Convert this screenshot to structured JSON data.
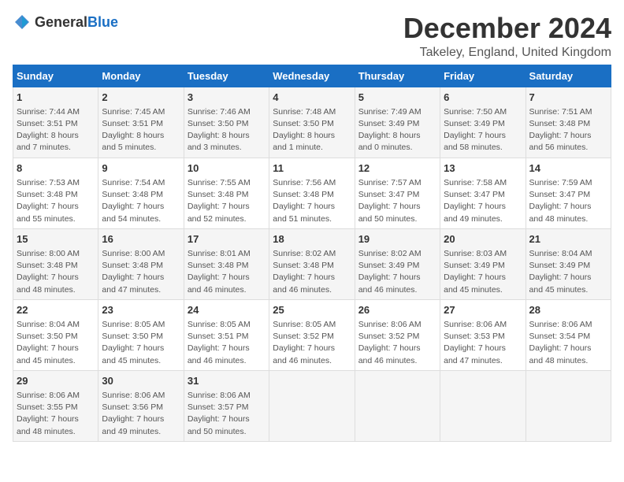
{
  "logo": {
    "general": "General",
    "blue": "Blue"
  },
  "title": "December 2024",
  "subtitle": "Takeley, England, United Kingdom",
  "days_of_week": [
    "Sunday",
    "Monday",
    "Tuesday",
    "Wednesday",
    "Thursday",
    "Friday",
    "Saturday"
  ],
  "weeks": [
    [
      {
        "day": "1",
        "info": "Sunrise: 7:44 AM\nSunset: 3:51 PM\nDaylight: 8 hours\nand 7 minutes."
      },
      {
        "day": "2",
        "info": "Sunrise: 7:45 AM\nSunset: 3:51 PM\nDaylight: 8 hours\nand 5 minutes."
      },
      {
        "day": "3",
        "info": "Sunrise: 7:46 AM\nSunset: 3:50 PM\nDaylight: 8 hours\nand 3 minutes."
      },
      {
        "day": "4",
        "info": "Sunrise: 7:48 AM\nSunset: 3:50 PM\nDaylight: 8 hours\nand 1 minute."
      },
      {
        "day": "5",
        "info": "Sunrise: 7:49 AM\nSunset: 3:49 PM\nDaylight: 8 hours\nand 0 minutes."
      },
      {
        "day": "6",
        "info": "Sunrise: 7:50 AM\nSunset: 3:49 PM\nDaylight: 7 hours\nand 58 minutes."
      },
      {
        "day": "7",
        "info": "Sunrise: 7:51 AM\nSunset: 3:48 PM\nDaylight: 7 hours\nand 56 minutes."
      }
    ],
    [
      {
        "day": "8",
        "info": "Sunrise: 7:53 AM\nSunset: 3:48 PM\nDaylight: 7 hours\nand 55 minutes."
      },
      {
        "day": "9",
        "info": "Sunrise: 7:54 AM\nSunset: 3:48 PM\nDaylight: 7 hours\nand 54 minutes."
      },
      {
        "day": "10",
        "info": "Sunrise: 7:55 AM\nSunset: 3:48 PM\nDaylight: 7 hours\nand 52 minutes."
      },
      {
        "day": "11",
        "info": "Sunrise: 7:56 AM\nSunset: 3:48 PM\nDaylight: 7 hours\nand 51 minutes."
      },
      {
        "day": "12",
        "info": "Sunrise: 7:57 AM\nSunset: 3:47 PM\nDaylight: 7 hours\nand 50 minutes."
      },
      {
        "day": "13",
        "info": "Sunrise: 7:58 AM\nSunset: 3:47 PM\nDaylight: 7 hours\nand 49 minutes."
      },
      {
        "day": "14",
        "info": "Sunrise: 7:59 AM\nSunset: 3:47 PM\nDaylight: 7 hours\nand 48 minutes."
      }
    ],
    [
      {
        "day": "15",
        "info": "Sunrise: 8:00 AM\nSunset: 3:48 PM\nDaylight: 7 hours\nand 48 minutes."
      },
      {
        "day": "16",
        "info": "Sunrise: 8:00 AM\nSunset: 3:48 PM\nDaylight: 7 hours\nand 47 minutes."
      },
      {
        "day": "17",
        "info": "Sunrise: 8:01 AM\nSunset: 3:48 PM\nDaylight: 7 hours\nand 46 minutes."
      },
      {
        "day": "18",
        "info": "Sunrise: 8:02 AM\nSunset: 3:48 PM\nDaylight: 7 hours\nand 46 minutes."
      },
      {
        "day": "19",
        "info": "Sunrise: 8:02 AM\nSunset: 3:49 PM\nDaylight: 7 hours\nand 46 minutes."
      },
      {
        "day": "20",
        "info": "Sunrise: 8:03 AM\nSunset: 3:49 PM\nDaylight: 7 hours\nand 45 minutes."
      },
      {
        "day": "21",
        "info": "Sunrise: 8:04 AM\nSunset: 3:49 PM\nDaylight: 7 hours\nand 45 minutes."
      }
    ],
    [
      {
        "day": "22",
        "info": "Sunrise: 8:04 AM\nSunset: 3:50 PM\nDaylight: 7 hours\nand 45 minutes."
      },
      {
        "day": "23",
        "info": "Sunrise: 8:05 AM\nSunset: 3:50 PM\nDaylight: 7 hours\nand 45 minutes."
      },
      {
        "day": "24",
        "info": "Sunrise: 8:05 AM\nSunset: 3:51 PM\nDaylight: 7 hours\nand 46 minutes."
      },
      {
        "day": "25",
        "info": "Sunrise: 8:05 AM\nSunset: 3:52 PM\nDaylight: 7 hours\nand 46 minutes."
      },
      {
        "day": "26",
        "info": "Sunrise: 8:06 AM\nSunset: 3:52 PM\nDaylight: 7 hours\nand 46 minutes."
      },
      {
        "day": "27",
        "info": "Sunrise: 8:06 AM\nSunset: 3:53 PM\nDaylight: 7 hours\nand 47 minutes."
      },
      {
        "day": "28",
        "info": "Sunrise: 8:06 AM\nSunset: 3:54 PM\nDaylight: 7 hours\nand 48 minutes."
      }
    ],
    [
      {
        "day": "29",
        "info": "Sunrise: 8:06 AM\nSunset: 3:55 PM\nDaylight: 7 hours\nand 48 minutes."
      },
      {
        "day": "30",
        "info": "Sunrise: 8:06 AM\nSunset: 3:56 PM\nDaylight: 7 hours\nand 49 minutes."
      },
      {
        "day": "31",
        "info": "Sunrise: 8:06 AM\nSunset: 3:57 PM\nDaylight: 7 hours\nand 50 minutes."
      },
      null,
      null,
      null,
      null
    ]
  ]
}
